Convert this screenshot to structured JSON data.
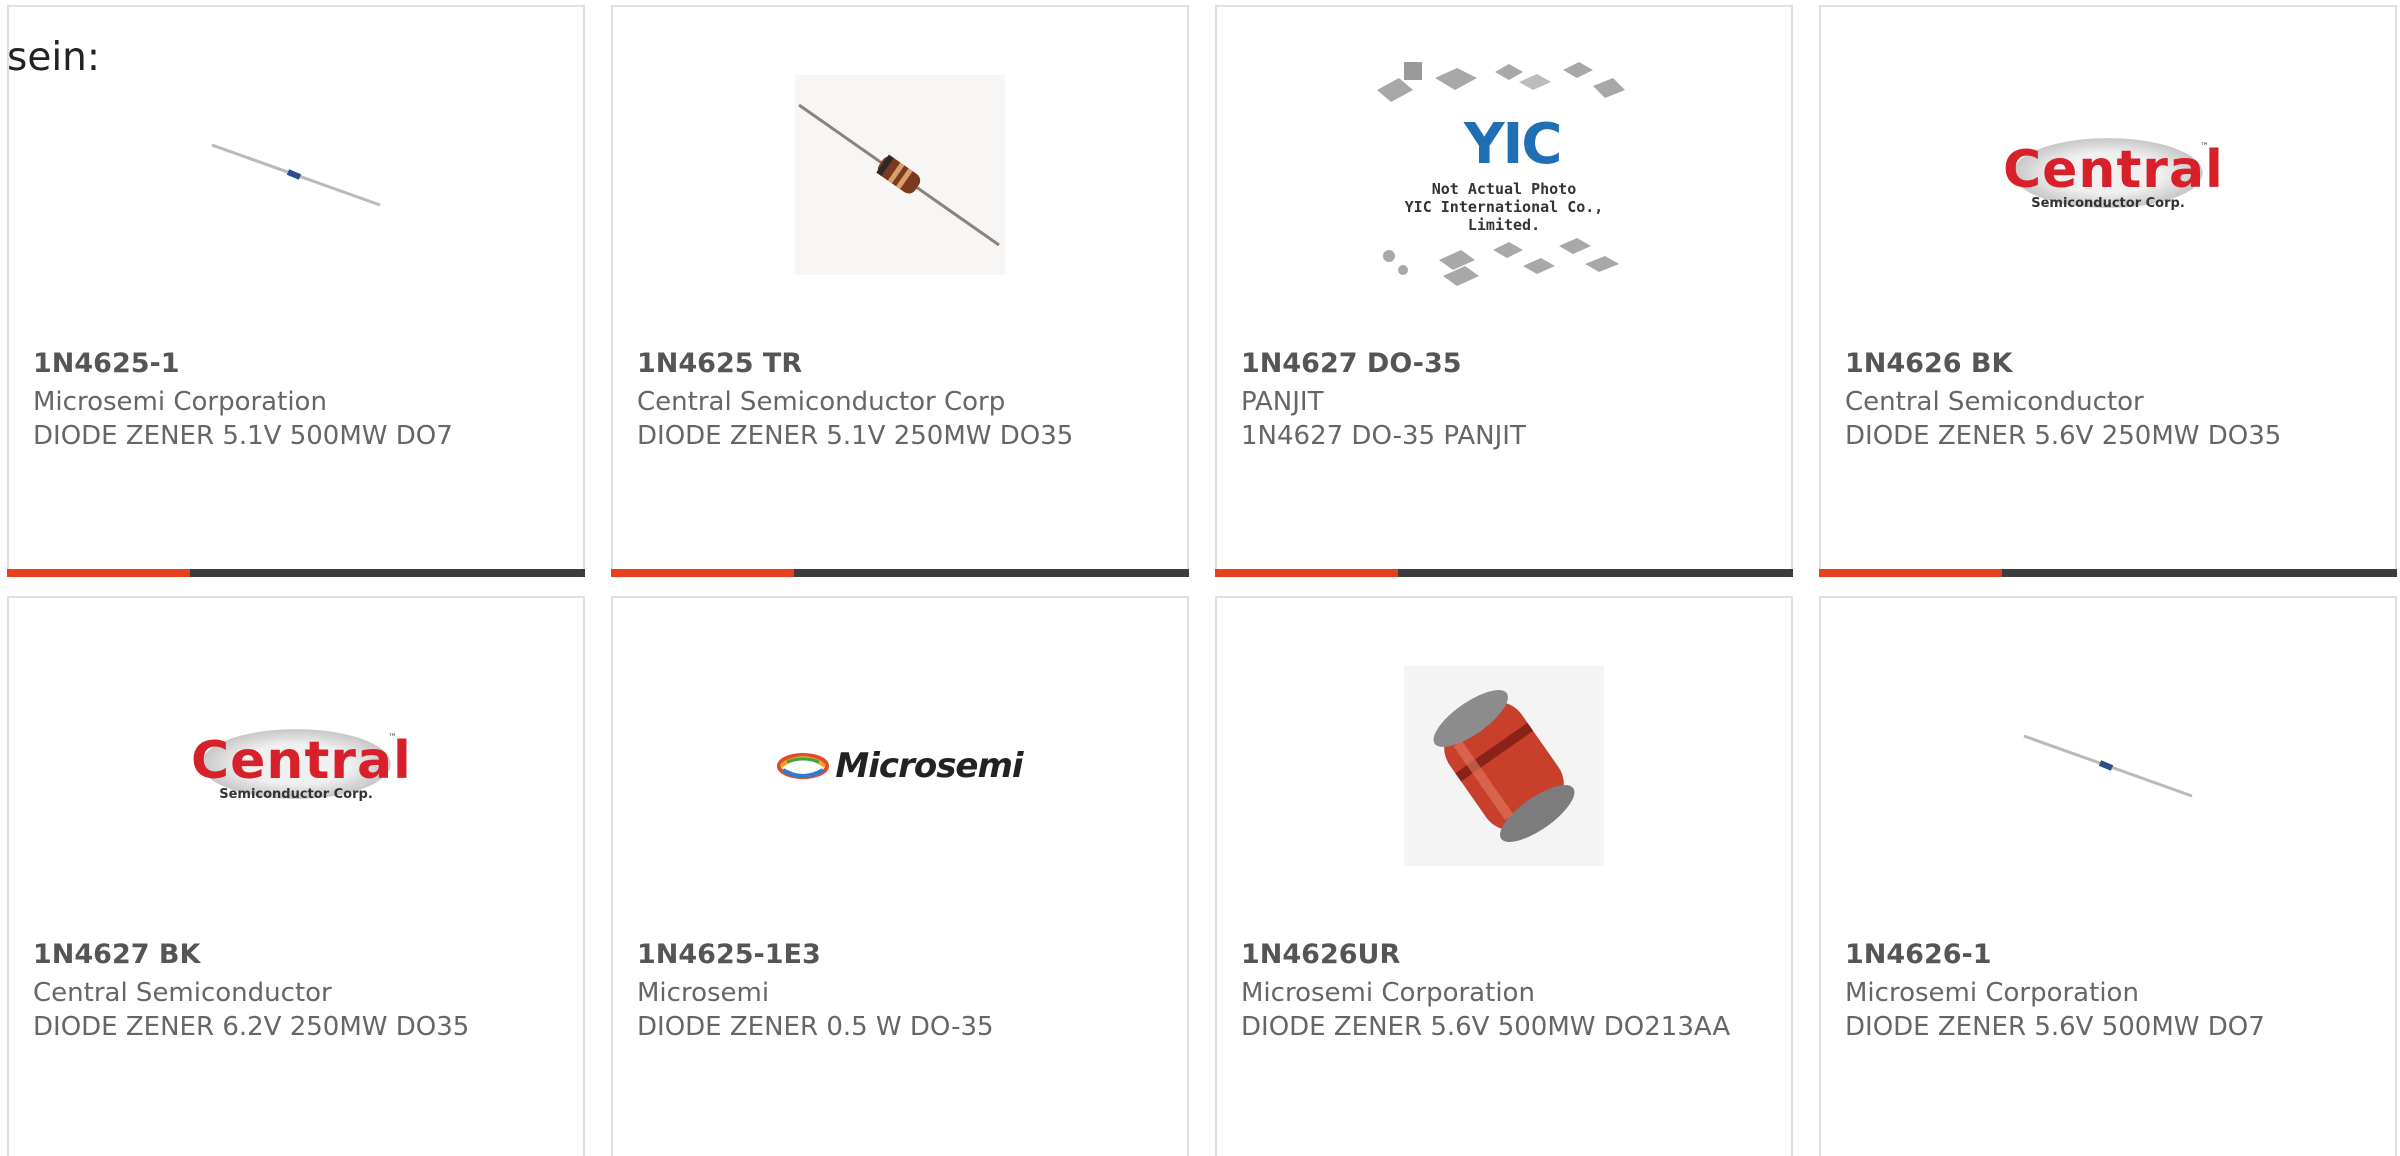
{
  "intro_text": "sein:",
  "colors": {
    "accent": "#e8401c",
    "bar": "#3c3c3c",
    "card_border": "#e0e0e0",
    "text": "#666666",
    "title": "#555555"
  },
  "products": [
    {
      "part_number": "1N4625-1",
      "manufacturer": "Microsemi Corporation",
      "description": "DIODE ZENER 5.1V 500MW DO7",
      "image": "axial-diode-thin-icon"
    },
    {
      "part_number": "1N4625 TR",
      "manufacturer": "Central Semiconductor Corp",
      "description": "DIODE ZENER 5.1V 250MW DO35",
      "image": "axial-diode-photo-icon"
    },
    {
      "part_number": "1N4627 DO-35",
      "manufacturer": "PANJIT",
      "description": "1N4627 DO-35 PANJIT",
      "image": "yic-placeholder-icon",
      "image_text": {
        "logo": "YIC",
        "line1": "Not Actual Photo",
        "line2": "YIC International Co., Limited."
      }
    },
    {
      "part_number": "1N4626 BK",
      "manufacturer": "Central Semiconductor",
      "description": "DIODE ZENER 5.6V 250MW DO35",
      "image": "central-logo",
      "image_text": {
        "logo": "Central",
        "sub": "Semiconductor Corp.",
        "tm": "™"
      }
    },
    {
      "part_number": "1N4627 BK",
      "manufacturer": "Central Semiconductor",
      "description": "DIODE ZENER 6.2V 250MW DO35",
      "image": "central-logo",
      "image_text": {
        "logo": "Central",
        "sub": "Semiconductor Corp.",
        "tm": "™"
      }
    },
    {
      "part_number": "1N4625-1E3",
      "manufacturer": "Microsemi",
      "description": "DIODE ZENER 0.5 W DO-35",
      "image": "microsemi-logo",
      "image_text": {
        "logo": "Microsemi"
      }
    },
    {
      "part_number": "1N4626UR",
      "manufacturer": "Microsemi Corporation",
      "description": "DIODE ZENER 5.6V 500MW DO213AA",
      "image": "melf-diode-icon"
    },
    {
      "part_number": "1N4626-1",
      "manufacturer": "Microsemi Corporation",
      "description": "DIODE ZENER 5.6V 500MW DO7",
      "image": "axial-diode-thin-icon"
    }
  ]
}
